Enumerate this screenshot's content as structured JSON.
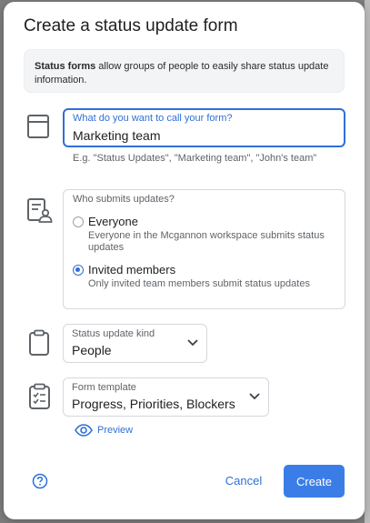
{
  "dialog": {
    "title": "Create a status update form",
    "info": {
      "bold": "Status forms",
      "text": " allow groups of people to easily share status update information."
    }
  },
  "name_field": {
    "label": "What do you want to call your form?",
    "value": "Marketing team",
    "hint": "E.g. \"Status Updates\", \"Marketing team\", \"John's team\""
  },
  "submitters": {
    "label": "Who submits updates?",
    "options": [
      {
        "title": "Everyone",
        "description": "Everyone in the Mcgannon workspace submits status updates",
        "selected": false
      },
      {
        "title": "Invited members",
        "description": "Only invited team members submit status updates",
        "selected": true
      }
    ]
  },
  "kind_select": {
    "label": "Status update kind",
    "value": "People"
  },
  "template_select": {
    "label": "Form template",
    "value": "Progress, Priorities, Blockers"
  },
  "preview": {
    "label": "Preview"
  },
  "footer": {
    "cancel_label": "Cancel",
    "create_label": "Create"
  },
  "colors": {
    "accent": "#2f6fd9",
    "primary_button": "#3b7de6",
    "icon_gray": "#5f6368",
    "backdrop": "#7d7d7d"
  },
  "icons": [
    "form-icon",
    "submitters-icon",
    "clipboard-icon",
    "checklist-icon",
    "eye-icon",
    "help-icon",
    "chevron-down-icon"
  ]
}
